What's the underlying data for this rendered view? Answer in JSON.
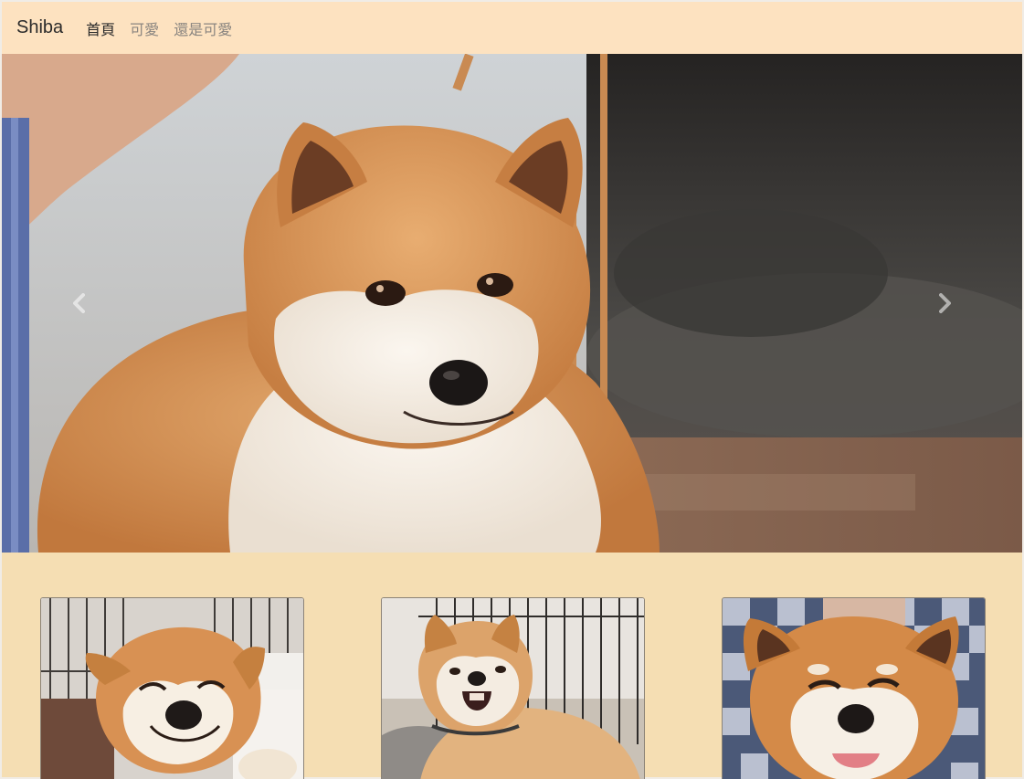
{
  "navbar": {
    "brand": "Shiba",
    "links": [
      {
        "label": "首頁",
        "active": true
      },
      {
        "label": "可愛",
        "active": false
      },
      {
        "label": "還是可愛",
        "active": false
      }
    ]
  },
  "carousel": {
    "image": "shiba-portrait-photo",
    "prev_icon": "chevron-left-icon",
    "next_icon": "chevron-right-icon"
  },
  "cards": [
    {
      "image": "smiling-shiba-photo"
    },
    {
      "image": "yawning-shiba-photo"
    },
    {
      "image": "tongue-out-shiba-photo"
    }
  ],
  "colors": {
    "navbar_bg": "#fde2c0",
    "page_bg": "#f5deb3",
    "active_link": "#2b2b2b",
    "inactive_link": "#8a8580"
  }
}
